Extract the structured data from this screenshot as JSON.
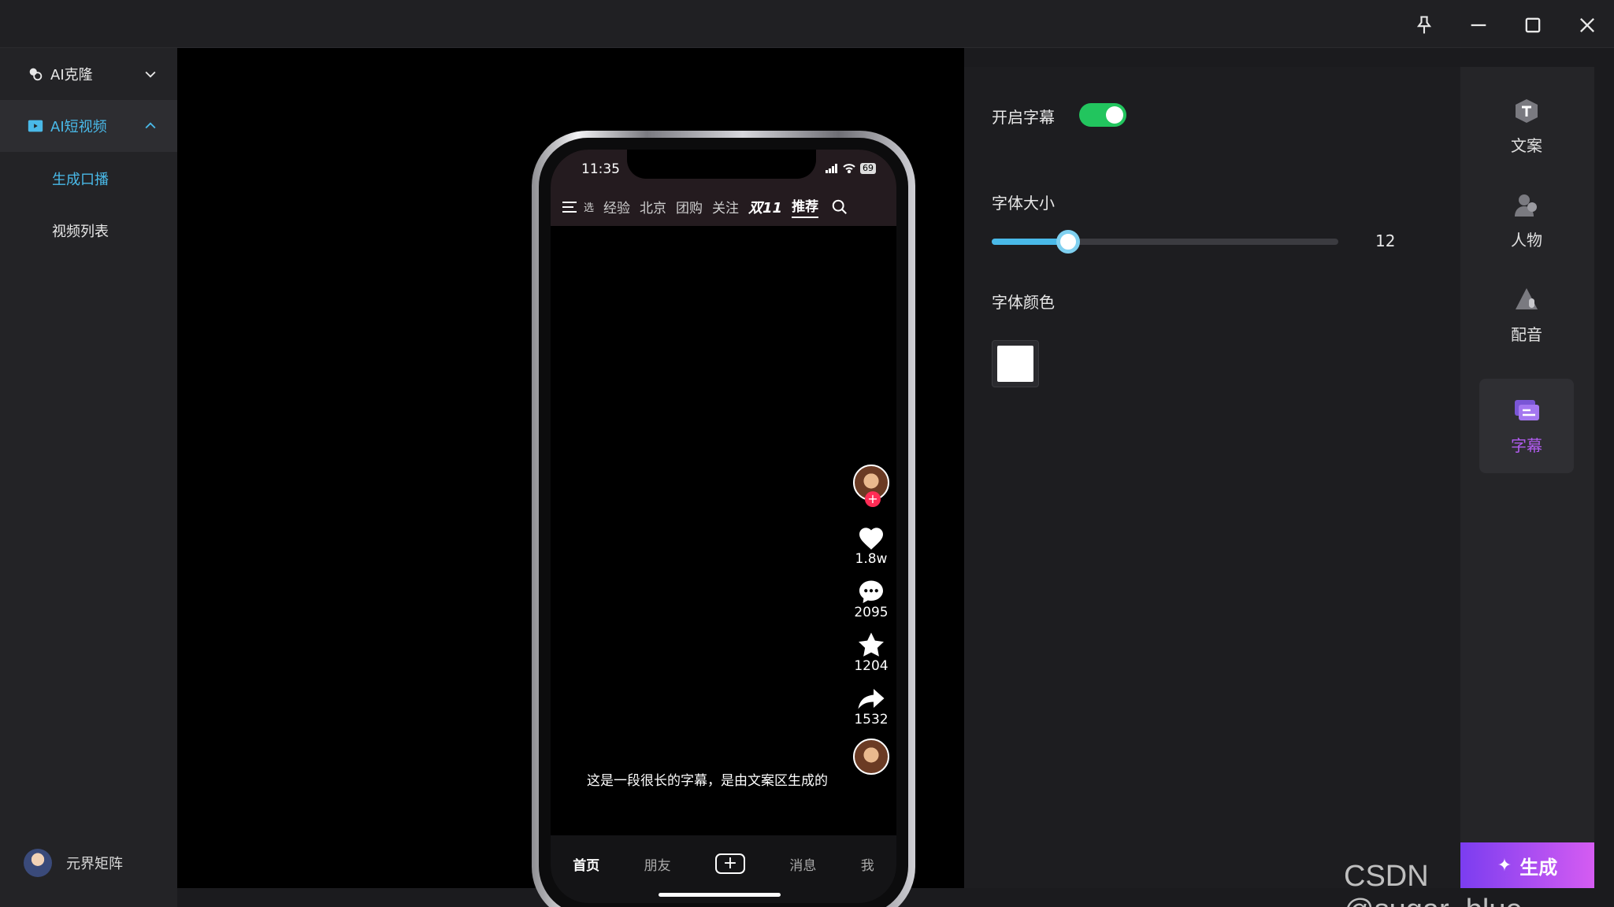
{
  "window": {
    "pin_icon": "pin-icon",
    "minimize_icon": "minimize-icon",
    "maximize_icon": "maximize-icon",
    "close_icon": "close-icon"
  },
  "sidebar": {
    "groups": [
      {
        "label": "AI克隆",
        "expanded": false
      },
      {
        "label": "AI短视频",
        "expanded": true
      }
    ],
    "sub_items": [
      "生成口播",
      "视频列表"
    ],
    "active_sub": 0,
    "user_name": "元界矩阵"
  },
  "phone": {
    "time": "11:35",
    "battery": "69",
    "top_tabs": [
      "选",
      "经验",
      "北京",
      "团购",
      "关注",
      "双11",
      "推荐"
    ],
    "selected_tab": "推荐",
    "counts": {
      "likes": "1.8w",
      "comments": "2095",
      "favorites": "1204",
      "shares": "1532"
    },
    "follow_plus": "+",
    "caption": "这是一段很长的字幕，是由文案区生成的",
    "bottom_nav": [
      "首页",
      "朋友",
      "消息",
      "我"
    ],
    "bottom_plus": "+"
  },
  "subtitle_settings": {
    "enable_label": "开启字幕",
    "enabled": true,
    "font_size_label": "字体大小",
    "font_size": "12",
    "font_size_fraction": 0.22,
    "font_color_label": "字体颜色",
    "font_color": "#ffffff",
    "accent_color": "#49b9e8"
  },
  "tools": [
    {
      "label": "文案",
      "icon": "copywriting-icon"
    },
    {
      "label": "人物",
      "icon": "person-icon"
    },
    {
      "label": "配音",
      "icon": "voice-icon"
    },
    {
      "label": "字幕",
      "icon": "subtitle-icon"
    }
  ],
  "active_tool": "字幕",
  "generate_button": "生成",
  "watermark": "CSDN @sugar_blue"
}
